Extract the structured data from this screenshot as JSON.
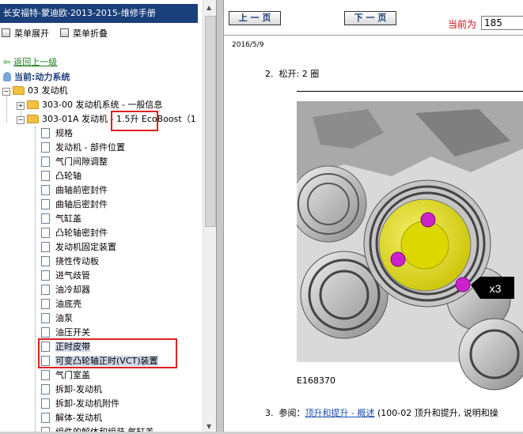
{
  "left_pane": {
    "title": "长安福特-蒙迪欧-2013-2015-维修手册",
    "menu": {
      "expand_label": "菜单展开",
      "collapse_label": "菜单折叠"
    },
    "back_label": "返回上一级",
    "current_label": "当前:动力系统",
    "tree": {
      "root": "03 发动机",
      "child1": "303-00 发动机系统 - 一般信息",
      "child2": "303-01A 发动机 - 1.5升 EcoBoost（1",
      "pages": [
        "规格",
        "发动机 - 部件位置",
        "气门间隙调整",
        "凸轮轴",
        "曲轴前密封件",
        "曲轴后密封件",
        "气缸盖",
        "凸轮轴密封件",
        "发动机固定装置",
        "挠性传动板",
        "进气歧管",
        "油冷却器",
        "油底壳",
        "油泵",
        "油压开关",
        "正时皮带",
        "可变凸轮轴正时(VCT)装置",
        "气门室盖",
        "拆卸-发动机",
        "拆卸-发动机附件",
        "解体-发动机",
        "组件的解体和组装 气缸盖"
      ]
    }
  },
  "toolbar": {
    "prev_label": "上 一 页",
    "next_label": "下 一 页",
    "current_page_label": "当前为",
    "current_page_value": "185"
  },
  "document": {
    "date": "2016/5/9",
    "step2_num": "2.",
    "step2_text": "松开: 2 圈",
    "figure_id": "E168370",
    "callout": "x3",
    "step3_num": "3.",
    "step3_prefix": "参阅：",
    "step3_link": "顶升和提升 - 概述",
    "step3_suffix": " (100-02 顶升和提升, 说明和操"
  },
  "colors": {
    "title_bar": "#1b3f7a",
    "highlight_box": "#e02020",
    "pulley_yellow": "#e6e010",
    "bolt_magenta": "#cc22cc"
  }
}
